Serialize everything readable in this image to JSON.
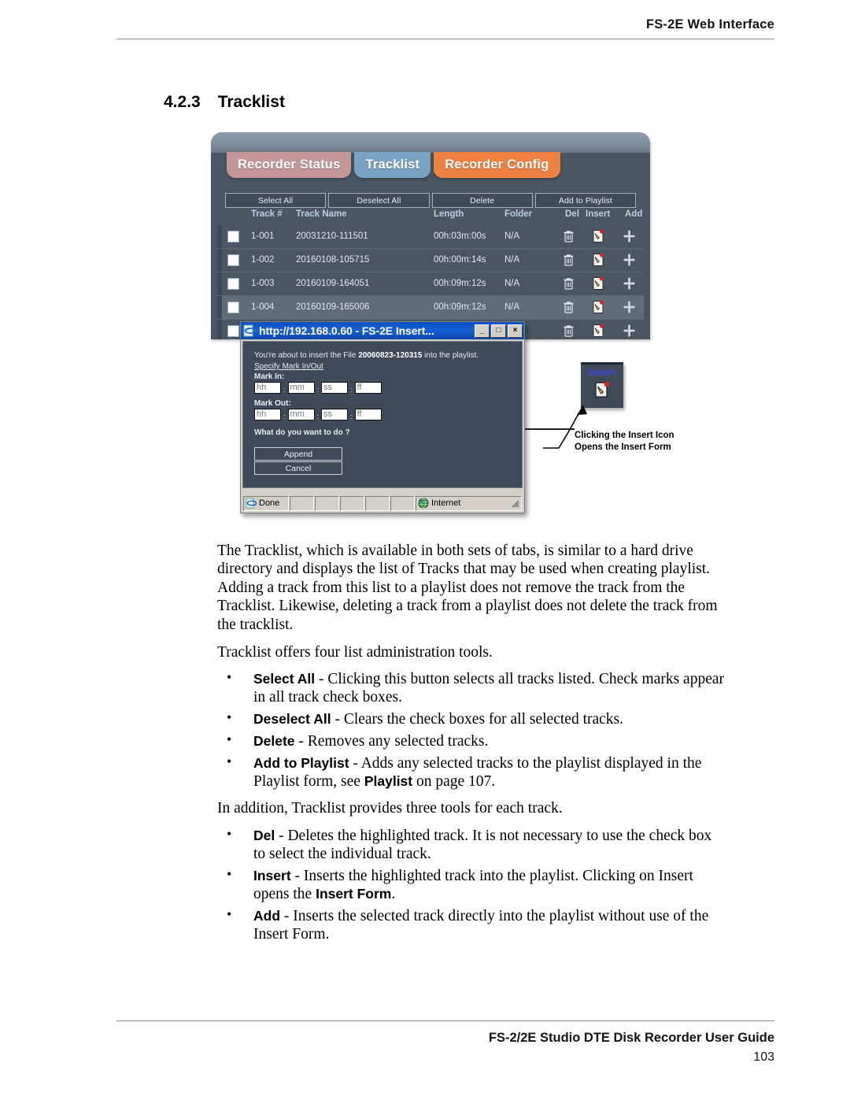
{
  "page": {
    "header_title": "FS-2E Web Interface",
    "section_number": "4.2.3",
    "section_title": "Tracklist",
    "footer_title": "FS-2/2E Studio DTE Disk Recorder User Guide",
    "page_number": "103"
  },
  "figure": {
    "app": {
      "tabs": [
        {
          "label": "Recorder Status",
          "color": "#c49698",
          "active": false
        },
        {
          "label": "Tracklist",
          "color": "#78a3c4",
          "active": true
        },
        {
          "label": "Recorder Config",
          "color": "#ef8242",
          "active": false
        }
      ],
      "toolbar": [
        {
          "label": "Select All"
        },
        {
          "label": "Deselect All"
        },
        {
          "label": "Delete"
        },
        {
          "label": "Add to Playlist"
        }
      ],
      "columns": {
        "track": "Track #",
        "name": "Track Name",
        "length": "Length",
        "folder": "Folder",
        "del": "Del",
        "insert": "Insert",
        "add": "Add"
      },
      "rows": [
        {
          "track": "1-001",
          "name": "20031210-111501",
          "length": "00h:03m:00s",
          "folder": "N/A"
        },
        {
          "track": "1-002",
          "name": "20160108-105715",
          "length": "00h:00m:14s",
          "folder": "N/A"
        },
        {
          "track": "1-003",
          "name": "20160109-164051",
          "length": "00h:09m:12s",
          "folder": "N/A"
        },
        {
          "track": "1-004",
          "name": "20160109-165006",
          "length": "00h:09m:12s",
          "folder": "N/A"
        },
        {
          "track": "",
          "name": "",
          "length": "",
          "folder": ""
        },
        {
          "track": "",
          "name": "",
          "length": "",
          "folder": ""
        }
      ]
    },
    "dialog": {
      "title": "http://192.168.0.60 - FS-2E  Insert...",
      "minimize_label": "_",
      "maximize_label": "□",
      "close_label": "×",
      "intro_prefix": "You're about to insert the File ",
      "intro_file": "20060823-120315",
      "intro_suffix": " into the playlist.",
      "spec_link": "Specify Mark In/Out",
      "mark_in_label": "Mark In:",
      "mark_out_label": "Mark Out:",
      "timecode_placeholders": [
        "hh",
        "mm",
        "ss",
        "ff"
      ],
      "timecode_separator": ":",
      "question": "What do you want to do ?",
      "append_label": "Append",
      "cancel_label": "Cancel",
      "status_done": "Done",
      "status_zone": "Internet"
    },
    "callout": {
      "tile_label": "Insert",
      "line1": "Clicking the Insert Icon",
      "line2": "Opens the Insert Form"
    }
  },
  "content": {
    "para1": "The Tracklist, which is available in both sets of tabs, is similar to a hard drive directory and displays the list of Tracks that may be used when creating playlist. Adding a track from this list to a playlist does not remove the track from the Tracklist. Likewise, deleting a track from a playlist does not delete the track from the tracklist.",
    "para2": "Tracklist offers four list administration tools.",
    "list1": [
      {
        "term": "Select All",
        "desc": " - Clicking this button selects all tracks listed. Check marks appear in all track check boxes."
      },
      {
        "term": "Deselect All",
        "desc": " - Clears the check boxes for all selected tracks."
      },
      {
        "term": "Delete",
        "desc": " - Removes any selected tracks."
      },
      {
        "term": "Add to Playlist",
        "desc": " - Adds any selected tracks to the playlist displayed in the Playlist form, see ",
        "term2": "Playlist",
        "desc2": " on page 107."
      }
    ],
    "para3": "In addition, Tracklist provides three tools for each track.",
    "list2": [
      {
        "term": "Del",
        "desc": " - Deletes the highlighted track. It is not necessary to use the check box to select the individual track."
      },
      {
        "term": "Insert",
        "desc": " - Inserts the highlighted track into the playlist. Clicking on Insert opens the ",
        "term2": "Insert Form",
        "desc2": "."
      },
      {
        "term": "Add",
        "desc": " - Inserts the selected track directly into the playlist without use of the Insert Form."
      }
    ]
  }
}
